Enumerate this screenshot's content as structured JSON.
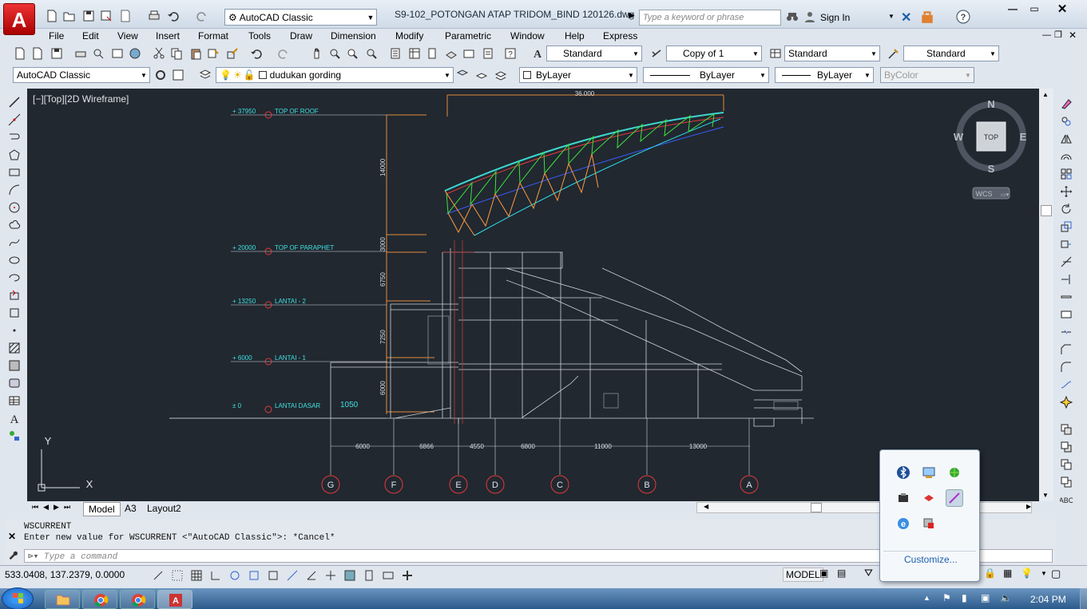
{
  "window": {
    "logo_letter": "A",
    "workspace": "AutoCAD Classic",
    "document_title": "S9-102_POTONGAN ATAP TRIDOM_BIND 120126.dwg",
    "search_placeholder": "Type a keyword or phrase",
    "sign_in": "Sign In"
  },
  "menu": [
    "File",
    "Edit",
    "View",
    "Insert",
    "Format",
    "Tools",
    "Draw",
    "Dimension",
    "Modify",
    "Parametric",
    "Window",
    "Help",
    "Express"
  ],
  "toolbar": {
    "text_style": "Standard",
    "dim_style": "Copy of 1",
    "table_style": "Standard",
    "mleader_style": "Standard",
    "workspace": "AutoCAD Classic",
    "layer": "dudukan gording",
    "color": "ByLayer",
    "linetype": "ByLayer",
    "lineweight": "ByLayer",
    "plot_style": "ByColor"
  },
  "viewport": {
    "label": "[−][Top][2D Wireframe]",
    "viewcube_top": "TOP",
    "compass": {
      "n": "N",
      "s": "S",
      "e": "E",
      "w": "W"
    },
    "wcs": "WCS",
    "ucs_x": "X",
    "ucs_y": "Y"
  },
  "drawing": {
    "levels": [
      {
        "elev": "+ 37950",
        "name": "TOP OF ROOF"
      },
      {
        "elev": "+ 20000",
        "name": "TOP OF PARAPHET"
      },
      {
        "elev": "+ 13250",
        "name": "LANTAI - 2"
      },
      {
        "elev": "+ 6000",
        "name": "LANTAI - 1"
      },
      {
        "elev": "± 0",
        "name": "LANTAI DASAR"
      }
    ],
    "extra_dim": "1050",
    "top_dim": "36.000",
    "vertical_dims": [
      "14000",
      "3000",
      "6750",
      "7250",
      "6000"
    ],
    "grid_labels": [
      "G",
      "F",
      "E",
      "D",
      "C",
      "B",
      "A"
    ],
    "grid_dims": [
      "6000",
      "6866",
      "4550",
      "6800",
      "11000",
      "13000"
    ]
  },
  "tabs": [
    "Model",
    "A3",
    "Layout2"
  ],
  "command": {
    "history": [
      "WSCURRENT",
      "Enter new value for WSCURRENT <\"AutoCAD Classic\">: *Cancel*"
    ],
    "placeholder": "Type a command"
  },
  "status": {
    "coords": "533.0408, 137.2379, 0.0000",
    "model": "MODEL"
  },
  "tray_popup": {
    "customize": "Customize..."
  },
  "taskbar": {
    "time": "2:04 PM"
  }
}
